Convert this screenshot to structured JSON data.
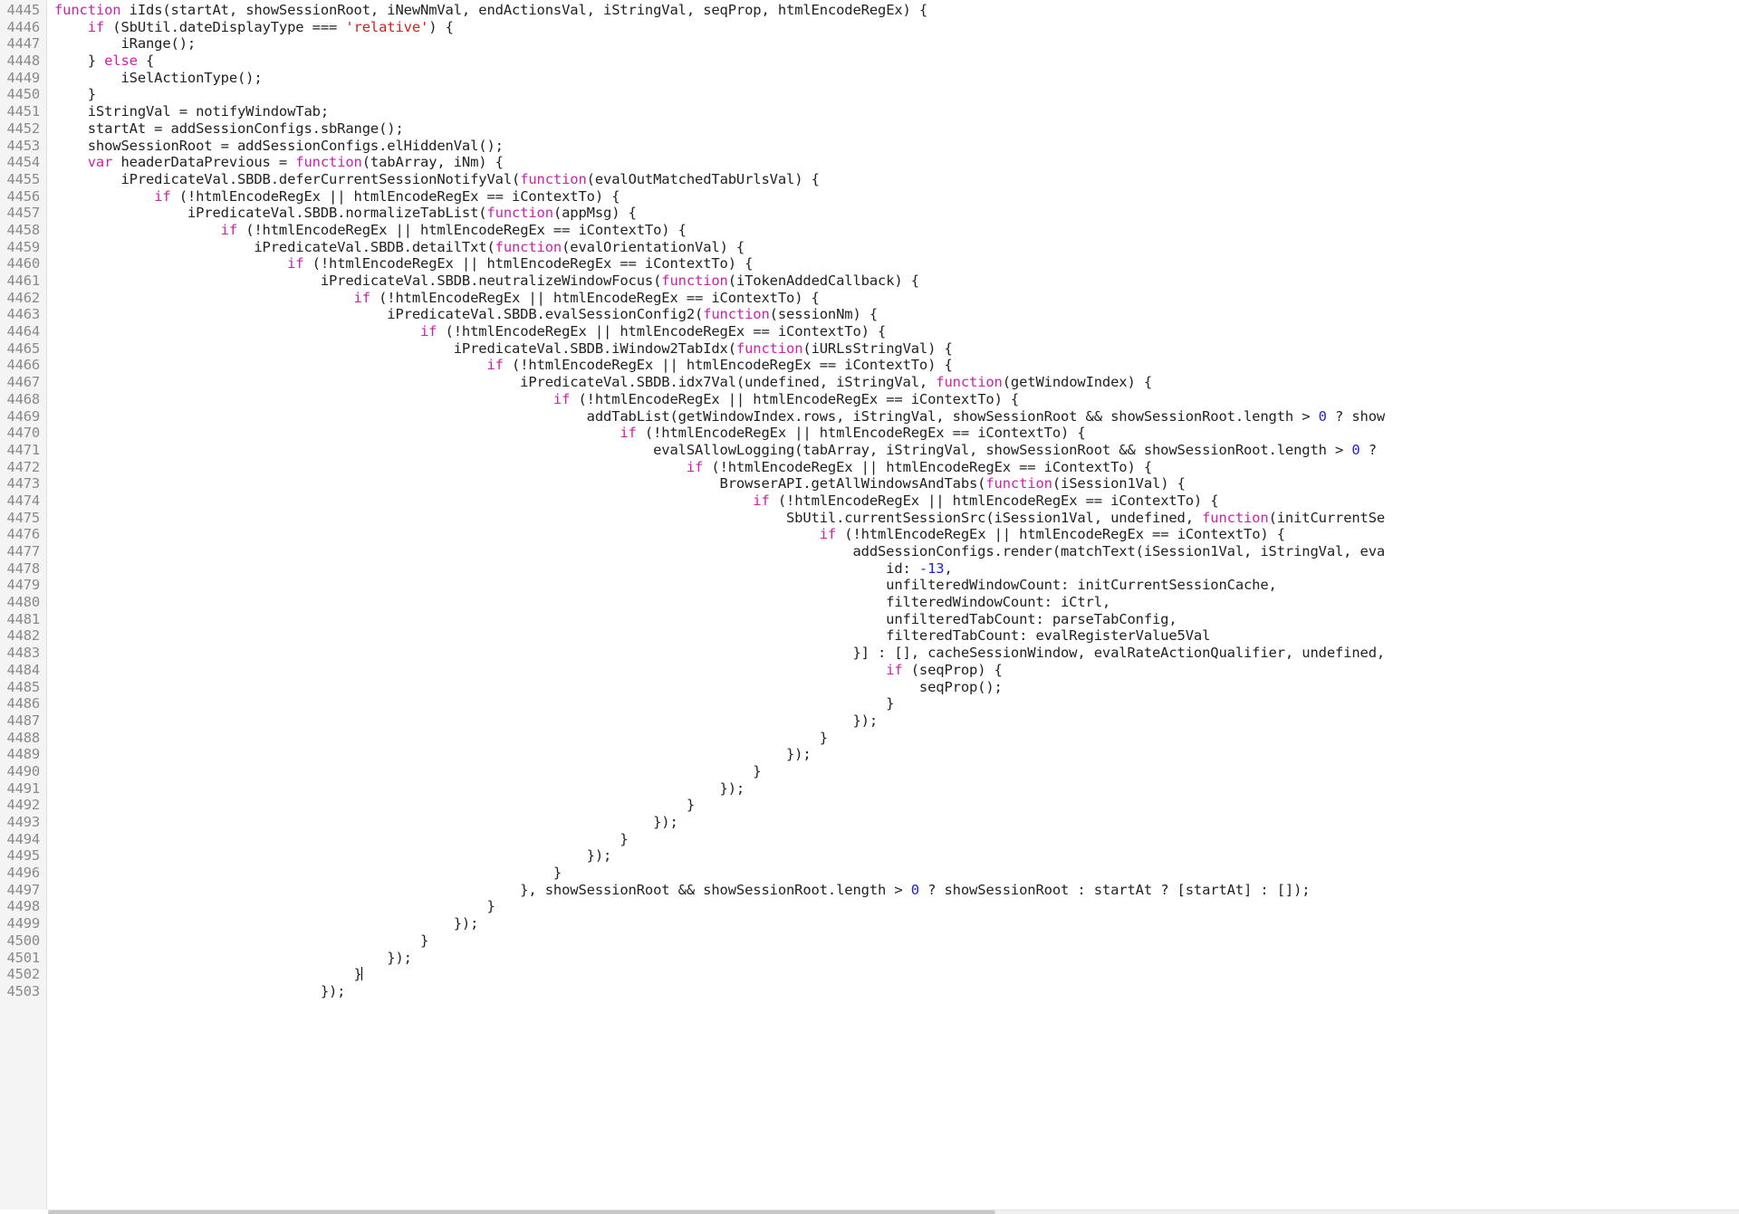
{
  "editor": {
    "language": "javascript",
    "first_line_number": 4445,
    "last_line_number": 4503,
    "cursor_line": 4502,
    "colors": {
      "background": "#ffffff",
      "gutter_background": "#f4f4f4",
      "gutter_border": "#dddddd",
      "line_number": "#8a8a8a",
      "text": "#222222",
      "keyword": "#cc22aa",
      "string": "#cc2222",
      "number": "#2222dd",
      "cursor": "#000000"
    },
    "lines": [
      {
        "n": 4445,
        "tokens": [
          {
            "t": "kw",
            "v": "function"
          },
          {
            "t": "plain",
            "v": " iIds(startAt, showSessionRoot, iNewNmVal, endActionsVal, iStringVal, seqProp, htmlEncodeRegEx) {"
          }
        ]
      },
      {
        "n": 4446,
        "tokens": [
          {
            "t": "plain",
            "v": "    "
          },
          {
            "t": "kw",
            "v": "if"
          },
          {
            "t": "plain",
            "v": " (SbUtil.dateDisplayType === "
          },
          {
            "t": "str",
            "v": "'relative'"
          },
          {
            "t": "plain",
            "v": ") {"
          }
        ]
      },
      {
        "n": 4447,
        "tokens": [
          {
            "t": "plain",
            "v": "        iRange();"
          }
        ]
      },
      {
        "n": 4448,
        "tokens": [
          {
            "t": "plain",
            "v": "    } "
          },
          {
            "t": "kw",
            "v": "else"
          },
          {
            "t": "plain",
            "v": " {"
          }
        ]
      },
      {
        "n": 4449,
        "tokens": [
          {
            "t": "plain",
            "v": "        iSelActionType();"
          }
        ]
      },
      {
        "n": 4450,
        "tokens": [
          {
            "t": "plain",
            "v": "    }"
          }
        ]
      },
      {
        "n": 4451,
        "tokens": [
          {
            "t": "plain",
            "v": "    iStringVal = notifyWindowTab;"
          }
        ]
      },
      {
        "n": 4452,
        "tokens": [
          {
            "t": "plain",
            "v": "    startAt = addSessionConfigs.sbRange();"
          }
        ]
      },
      {
        "n": 4453,
        "tokens": [
          {
            "t": "plain",
            "v": "    showSessionRoot = addSessionConfigs.elHiddenVal();"
          }
        ]
      },
      {
        "n": 4454,
        "tokens": [
          {
            "t": "plain",
            "v": "    "
          },
          {
            "t": "kw",
            "v": "var"
          },
          {
            "t": "plain",
            "v": " headerDataPrevious = "
          },
          {
            "t": "kw",
            "v": "function"
          },
          {
            "t": "plain",
            "v": "(tabArray, iNm) {"
          }
        ]
      },
      {
        "n": 4455,
        "tokens": [
          {
            "t": "plain",
            "v": "        iPredicateVal.SBDB.deferCurrentSessionNotifyVal("
          },
          {
            "t": "kw",
            "v": "function"
          },
          {
            "t": "plain",
            "v": "(evalOutMatchedTabUrlsVal) {"
          }
        ]
      },
      {
        "n": 4456,
        "tokens": [
          {
            "t": "plain",
            "v": "            "
          },
          {
            "t": "kw",
            "v": "if"
          },
          {
            "t": "plain",
            "v": " (!htmlEncodeRegEx || htmlEncodeRegEx == iContextTo) {"
          }
        ]
      },
      {
        "n": 4457,
        "tokens": [
          {
            "t": "plain",
            "v": "                iPredicateVal.SBDB.normalizeTabList("
          },
          {
            "t": "kw",
            "v": "function"
          },
          {
            "t": "plain",
            "v": "(appMsg) {"
          }
        ]
      },
      {
        "n": 4458,
        "tokens": [
          {
            "t": "plain",
            "v": "                    "
          },
          {
            "t": "kw",
            "v": "if"
          },
          {
            "t": "plain",
            "v": " (!htmlEncodeRegEx || htmlEncodeRegEx == iContextTo) {"
          }
        ]
      },
      {
        "n": 4459,
        "tokens": [
          {
            "t": "plain",
            "v": "                        iPredicateVal.SBDB.detailTxt("
          },
          {
            "t": "kw",
            "v": "function"
          },
          {
            "t": "plain",
            "v": "(evalOrientationVal) {"
          }
        ]
      },
      {
        "n": 4460,
        "tokens": [
          {
            "t": "plain",
            "v": "                            "
          },
          {
            "t": "kw",
            "v": "if"
          },
          {
            "t": "plain",
            "v": " (!htmlEncodeRegEx || htmlEncodeRegEx == iContextTo) {"
          }
        ]
      },
      {
        "n": 4461,
        "tokens": [
          {
            "t": "plain",
            "v": "                                iPredicateVal.SBDB.neutralizeWindowFocus("
          },
          {
            "t": "kw",
            "v": "function"
          },
          {
            "t": "plain",
            "v": "(iTokenAddedCallback) {"
          }
        ]
      },
      {
        "n": 4462,
        "tokens": [
          {
            "t": "plain",
            "v": "                                    "
          },
          {
            "t": "kw",
            "v": "if"
          },
          {
            "t": "plain",
            "v": " (!htmlEncodeRegEx || htmlEncodeRegEx == iContextTo) {"
          }
        ]
      },
      {
        "n": 4463,
        "tokens": [
          {
            "t": "plain",
            "v": "                                        iPredicateVal.SBDB.evalSessionConfig2("
          },
          {
            "t": "kw",
            "v": "function"
          },
          {
            "t": "plain",
            "v": "(sessionNm) {"
          }
        ]
      },
      {
        "n": 4464,
        "tokens": [
          {
            "t": "plain",
            "v": "                                            "
          },
          {
            "t": "kw",
            "v": "if"
          },
          {
            "t": "plain",
            "v": " (!htmlEncodeRegEx || htmlEncodeRegEx == iContextTo) {"
          }
        ]
      },
      {
        "n": 4465,
        "tokens": [
          {
            "t": "plain",
            "v": "                                                iPredicateVal.SBDB.iWindow2TabIdx("
          },
          {
            "t": "kw",
            "v": "function"
          },
          {
            "t": "plain",
            "v": "(iURLsStringVal) {"
          }
        ]
      },
      {
        "n": 4466,
        "tokens": [
          {
            "t": "plain",
            "v": "                                                    "
          },
          {
            "t": "kw",
            "v": "if"
          },
          {
            "t": "plain",
            "v": " (!htmlEncodeRegEx || htmlEncodeRegEx == iContextTo) {"
          }
        ]
      },
      {
        "n": 4467,
        "tokens": [
          {
            "t": "plain",
            "v": "                                                        iPredicateVal.SBDB.idx7Val(undefined, iStringVal, "
          },
          {
            "t": "kw",
            "v": "function"
          },
          {
            "t": "plain",
            "v": "(getWindowIndex) {"
          }
        ]
      },
      {
        "n": 4468,
        "tokens": [
          {
            "t": "plain",
            "v": "                                                            "
          },
          {
            "t": "kw",
            "v": "if"
          },
          {
            "t": "plain",
            "v": " (!htmlEncodeRegEx || htmlEncodeRegEx == iContextTo) {"
          }
        ]
      },
      {
        "n": 4469,
        "tokens": [
          {
            "t": "plain",
            "v": "                                                                addTabList(getWindowIndex.rows, iStringVal, showSessionRoot && showSessionRoot.length > "
          },
          {
            "t": "num",
            "v": "0"
          },
          {
            "t": "plain",
            "v": " ? show"
          }
        ]
      },
      {
        "n": 4470,
        "tokens": [
          {
            "t": "plain",
            "v": "                                                                    "
          },
          {
            "t": "kw",
            "v": "if"
          },
          {
            "t": "plain",
            "v": " (!htmlEncodeRegEx || htmlEncodeRegEx == iContextTo) {"
          }
        ]
      },
      {
        "n": 4471,
        "tokens": [
          {
            "t": "plain",
            "v": "                                                                        evalSAllowLogging(tabArray, iStringVal, showSessionRoot && showSessionRoot.length > "
          },
          {
            "t": "num",
            "v": "0"
          },
          {
            "t": "plain",
            "v": " ? "
          }
        ]
      },
      {
        "n": 4472,
        "tokens": [
          {
            "t": "plain",
            "v": "                                                                            "
          },
          {
            "t": "kw",
            "v": "if"
          },
          {
            "t": "plain",
            "v": " (!htmlEncodeRegEx || htmlEncodeRegEx == iContextTo) {"
          }
        ]
      },
      {
        "n": 4473,
        "tokens": [
          {
            "t": "plain",
            "v": "                                                                                BrowserAPI.getAllWindowsAndTabs("
          },
          {
            "t": "kw",
            "v": "function"
          },
          {
            "t": "plain",
            "v": "(iSession1Val) {"
          }
        ]
      },
      {
        "n": 4474,
        "tokens": [
          {
            "t": "plain",
            "v": "                                                                                    "
          },
          {
            "t": "kw",
            "v": "if"
          },
          {
            "t": "plain",
            "v": " (!htmlEncodeRegEx || htmlEncodeRegEx == iContextTo) {"
          }
        ]
      },
      {
        "n": 4475,
        "tokens": [
          {
            "t": "plain",
            "v": "                                                                                        SbUtil.currentSessionSrc(iSession1Val, undefined, "
          },
          {
            "t": "kw",
            "v": "function"
          },
          {
            "t": "plain",
            "v": "(initCurrentSe"
          }
        ]
      },
      {
        "n": 4476,
        "tokens": [
          {
            "t": "plain",
            "v": "                                                                                            "
          },
          {
            "t": "kw",
            "v": "if"
          },
          {
            "t": "plain",
            "v": " (!htmlEncodeRegEx || htmlEncodeRegEx == iContextTo) {"
          }
        ]
      },
      {
        "n": 4477,
        "tokens": [
          {
            "t": "plain",
            "v": "                                                                                                addSessionConfigs.render(matchText(iSession1Val, iStringVal, eva"
          }
        ]
      },
      {
        "n": 4478,
        "tokens": [
          {
            "t": "plain",
            "v": "                                                                                                    id: "
          },
          {
            "t": "num",
            "v": "-13"
          },
          {
            "t": "plain",
            "v": ","
          }
        ]
      },
      {
        "n": 4479,
        "tokens": [
          {
            "t": "plain",
            "v": "                                                                                                    unfilteredWindowCount: initCurrentSessionCache,"
          }
        ]
      },
      {
        "n": 4480,
        "tokens": [
          {
            "t": "plain",
            "v": "                                                                                                    filteredWindowCount: iCtrl,"
          }
        ]
      },
      {
        "n": 4481,
        "tokens": [
          {
            "t": "plain",
            "v": "                                                                                                    unfilteredTabCount: parseTabConfig,"
          }
        ]
      },
      {
        "n": 4482,
        "tokens": [
          {
            "t": "plain",
            "v": "                                                                                                    filteredTabCount: evalRegisterValue5Val"
          }
        ]
      },
      {
        "n": 4483,
        "tokens": [
          {
            "t": "plain",
            "v": "                                                                                                }] : [], cacheSessionWindow, evalRateActionQualifier, undefined,"
          }
        ]
      },
      {
        "n": 4484,
        "tokens": [
          {
            "t": "plain",
            "v": "                                                                                                    "
          },
          {
            "t": "kw",
            "v": "if"
          },
          {
            "t": "plain",
            "v": " (seqProp) {"
          }
        ]
      },
      {
        "n": 4485,
        "tokens": [
          {
            "t": "plain",
            "v": "                                                                                                        seqProp();"
          }
        ]
      },
      {
        "n": 4486,
        "tokens": [
          {
            "t": "plain",
            "v": "                                                                                                    }"
          }
        ]
      },
      {
        "n": 4487,
        "tokens": [
          {
            "t": "plain",
            "v": "                                                                                                });"
          }
        ]
      },
      {
        "n": 4488,
        "tokens": [
          {
            "t": "plain",
            "v": "                                                                                            }"
          }
        ]
      },
      {
        "n": 4489,
        "tokens": [
          {
            "t": "plain",
            "v": "                                                                                        });"
          }
        ]
      },
      {
        "n": 4490,
        "tokens": [
          {
            "t": "plain",
            "v": "                                                                                    }"
          }
        ]
      },
      {
        "n": 4491,
        "tokens": [
          {
            "t": "plain",
            "v": "                                                                                });"
          }
        ]
      },
      {
        "n": 4492,
        "tokens": [
          {
            "t": "plain",
            "v": "                                                                            }"
          }
        ]
      },
      {
        "n": 4493,
        "tokens": [
          {
            "t": "plain",
            "v": "                                                                        });"
          }
        ]
      },
      {
        "n": 4494,
        "tokens": [
          {
            "t": "plain",
            "v": "                                                                    }"
          }
        ]
      },
      {
        "n": 4495,
        "tokens": [
          {
            "t": "plain",
            "v": "                                                                });"
          }
        ]
      },
      {
        "n": 4496,
        "tokens": [
          {
            "t": "plain",
            "v": "                                                            }"
          }
        ]
      },
      {
        "n": 4497,
        "tokens": [
          {
            "t": "plain",
            "v": "                                                        }, showSessionRoot && showSessionRoot.length > "
          },
          {
            "t": "num",
            "v": "0"
          },
          {
            "t": "plain",
            "v": " ? showSessionRoot : startAt ? [startAt] : []);"
          }
        ]
      },
      {
        "n": 4498,
        "tokens": [
          {
            "t": "plain",
            "v": "                                                    }"
          }
        ]
      },
      {
        "n": 4499,
        "tokens": [
          {
            "t": "plain",
            "v": "                                                });"
          }
        ]
      },
      {
        "n": 4500,
        "tokens": [
          {
            "t": "plain",
            "v": "                                            }"
          }
        ]
      },
      {
        "n": 4501,
        "tokens": [
          {
            "t": "plain",
            "v": "                                        });"
          }
        ]
      },
      {
        "n": 4502,
        "tokens": [
          {
            "t": "plain",
            "v": "                                    }"
          },
          {
            "t": "cursor",
            "v": ""
          }
        ]
      },
      {
        "n": 4503,
        "tokens": [
          {
            "t": "plain",
            "v": "                                });"
          }
        ]
      }
    ]
  }
}
